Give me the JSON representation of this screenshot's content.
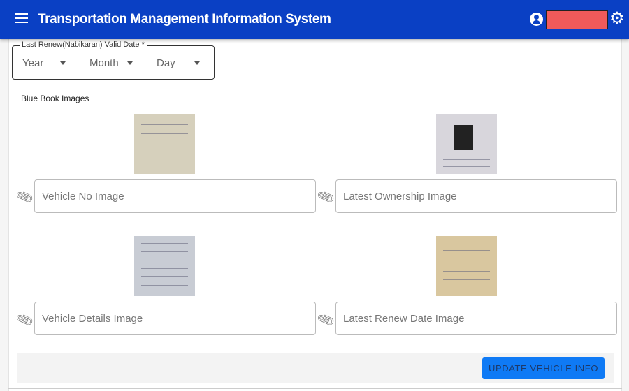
{
  "header": {
    "title": "Transportation Management Information System",
    "menu_icon": "hamburger-icon",
    "user_icon": "account-circle-icon",
    "settings_icon": "gear-icon"
  },
  "date": {
    "legend": "Last Renew(Nabikaran) Valid Date *",
    "year": "Year",
    "month": "Month",
    "day": "Day"
  },
  "section_title": "Blue Book Images",
  "images": [
    {
      "placeholder": "Vehicle No Image"
    },
    {
      "placeholder": "Latest Ownership Image"
    },
    {
      "placeholder": "Vehicle Details Image"
    },
    {
      "placeholder": "Latest Renew Date Image"
    }
  ],
  "submit_label": "UPDATE VEHICLE INFO",
  "colors": {
    "header": "#0a40c4",
    "button": "#0f7af5"
  }
}
